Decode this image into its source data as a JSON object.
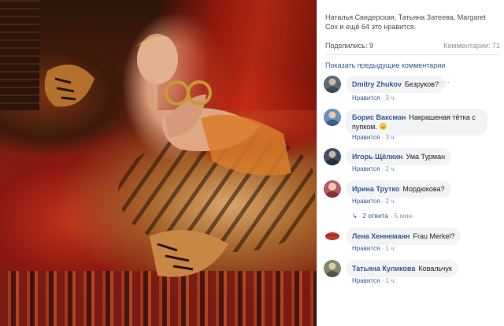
{
  "photo": {
    "alt_icon": "photo-of-woman-with-tigers"
  },
  "post": {
    "likes_text": "Наталья Свидерская, Татьяна Затеева, Margaret Cox и ещё 64 это нравится.",
    "shares_label": "Поделились: 9",
    "comments_label": "Комментарии: 71",
    "show_previous": "Показать предыдущие комментарии"
  },
  "comments": [
    {
      "author": "Dmitry Zhukov",
      "text": "Безруков?",
      "like": "Нравится",
      "time": "3 ч.",
      "avatar_color": "#5a6b78"
    },
    {
      "author": "Борис Ваксман",
      "text": "Накрашеная тётка с пупком.",
      "like": "Нравится",
      "time": "3 ч.",
      "avatar_color": "#6a8fb8",
      "emoji": "smile-emoji"
    },
    {
      "author": "Игорь Щёлкин",
      "text": "Ума Турман",
      "like": "Нравится",
      "time": "2 ч.",
      "avatar_color": "#3d4f66"
    },
    {
      "author": "Ирина Трутко",
      "text": "Мордюкова?",
      "like": "Нравится",
      "time": "2 ч.",
      "avatar_color": "#b55a63",
      "replies": "2 ответа",
      "replies_time": "5 мин."
    },
    {
      "author": "Лена Хеннеманн",
      "text": "Frau Merkel?",
      "like": "Нравится",
      "time": "1 ч.",
      "avatar_color": "#c23a2f"
    },
    {
      "author": "Татьяна Куликова",
      "text": "Ковальчук",
      "like": "Нравится",
      "time": "1 ч.",
      "avatar_color": "#7c8a6a"
    }
  ],
  "dot_sep": "·",
  "menu_dots": "···"
}
